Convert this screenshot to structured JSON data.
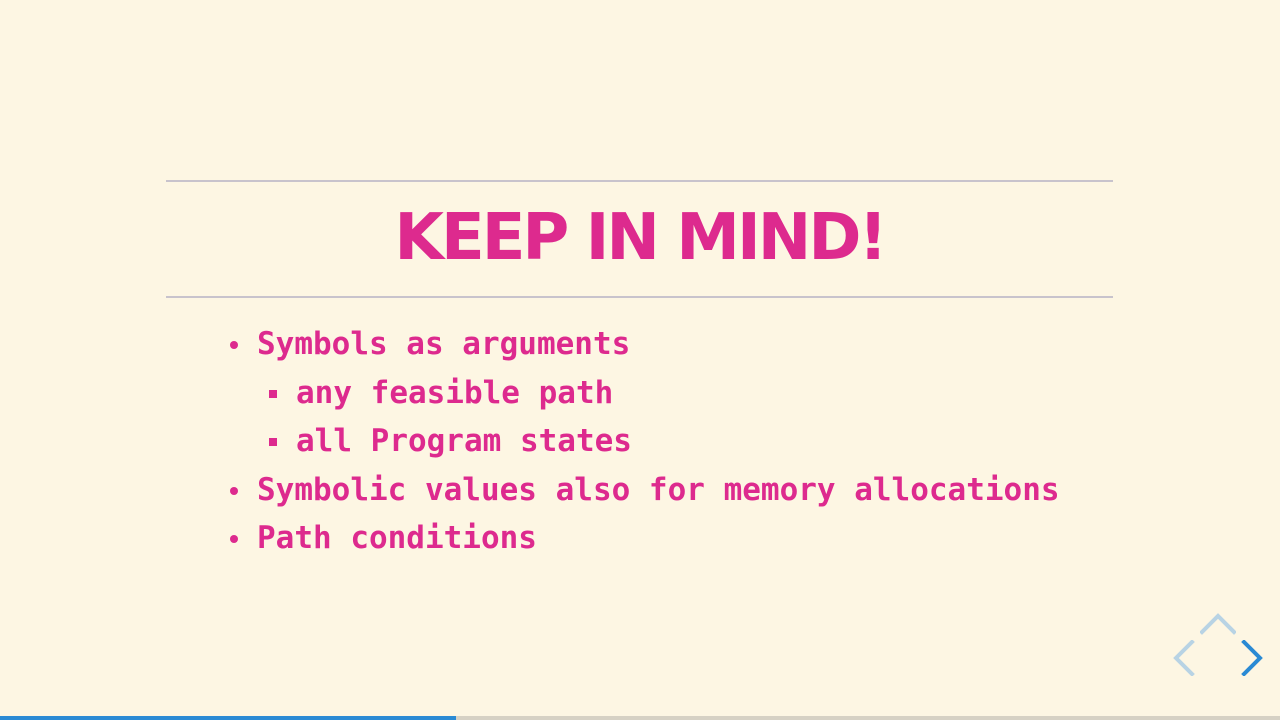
{
  "slide": {
    "title": "Keep in mind!",
    "bullets": [
      {
        "level": 1,
        "text": "Symbols as arguments"
      },
      {
        "level": 2,
        "text": "any feasible path"
      },
      {
        "level": 2,
        "text": "all Program states"
      },
      {
        "level": 1,
        "text": "Symbolic values also for memory allocations"
      },
      {
        "level": 1,
        "text": "Path conditions"
      }
    ]
  },
  "navigation": {
    "up_icon": "chevron-up-icon",
    "left_icon": "chevron-left-icon",
    "right_icon": "chevron-right-icon",
    "enabled_color": "#2a8ad4",
    "disabled_color": "#b8d3e4"
  },
  "progress": {
    "fraction": 0.356,
    "fill_color": "#2a8ad4",
    "track_color": "#d6d1c4"
  },
  "colors": {
    "background": "#fdf6e3",
    "accent": "#dd2a8e",
    "rule": "#c8c3cc"
  }
}
